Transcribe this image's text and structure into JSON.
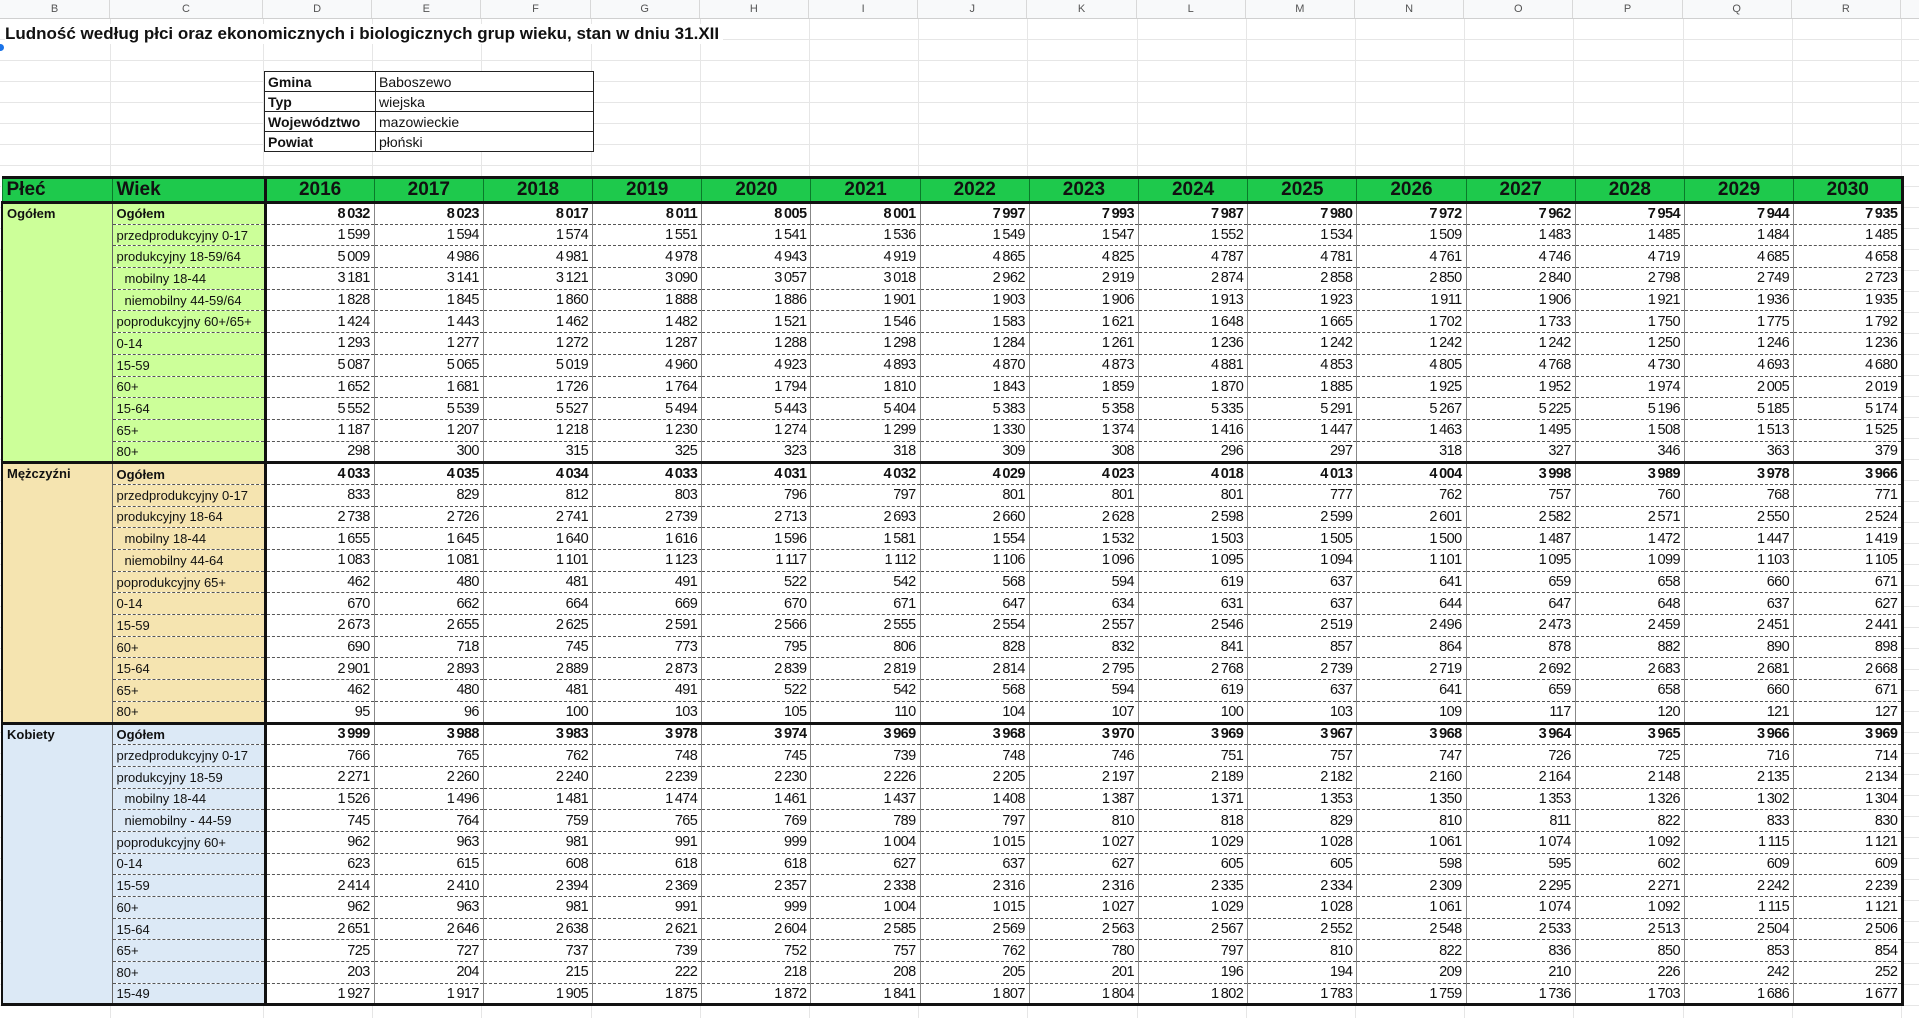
{
  "sheet": {
    "column_letters": [
      "B",
      "C",
      "D",
      "E",
      "F",
      "G",
      "H",
      "I",
      "J",
      "K",
      "L",
      "M",
      "N",
      "O",
      "P",
      "Q",
      "R"
    ]
  },
  "title": "Ludność według płci oraz ekonomicznych i biologicznych grup wieku, stan w dniu 31.XII",
  "info": [
    {
      "label": "Gmina",
      "value": "Baboszewo"
    },
    {
      "label": "Typ",
      "value": "wiejska"
    },
    {
      "label": "Województwo",
      "value": "mazowieckie"
    },
    {
      "label": "Powiat",
      "value": "płoński"
    }
  ],
  "table": {
    "header": {
      "plec": "Płeć",
      "wiek": "Wiek",
      "years": [
        "2016",
        "2017",
        "2018",
        "2019",
        "2020",
        "2021",
        "2022",
        "2023",
        "2024",
        "2025",
        "2026",
        "2027",
        "2028",
        "2029",
        "2030"
      ]
    },
    "header_color": "#1ec94c",
    "sections": [
      {
        "name": "Ogółem",
        "color": "#ccff99",
        "rows": [
          {
            "label": "Ogółem",
            "bold": true,
            "values": [
              8032,
              8023,
              8017,
              8011,
              8005,
              8001,
              7997,
              7993,
              7987,
              7980,
              7972,
              7962,
              7954,
              7944,
              7935
            ]
          },
          {
            "label": "przedprodukcyjny 0-17",
            "values": [
              1599,
              1594,
              1574,
              1551,
              1541,
              1536,
              1549,
              1547,
              1552,
              1534,
              1509,
              1483,
              1485,
              1484,
              1485
            ]
          },
          {
            "label": "produkcyjny 18-59/64",
            "values": [
              5009,
              4986,
              4981,
              4978,
              4943,
              4919,
              4865,
              4825,
              4787,
              4781,
              4761,
              4746,
              4719,
              4685,
              4658
            ]
          },
          {
            "label": "mobilny 18-44",
            "indent": true,
            "values": [
              3181,
              3141,
              3121,
              3090,
              3057,
              3018,
              2962,
              2919,
              2874,
              2858,
              2850,
              2840,
              2798,
              2749,
              2723
            ]
          },
          {
            "label": "niemobilny  44-59/64",
            "indent": true,
            "values": [
              1828,
              1845,
              1860,
              1888,
              1886,
              1901,
              1903,
              1906,
              1913,
              1923,
              1911,
              1906,
              1921,
              1936,
              1935
            ]
          },
          {
            "label": "poprodukcyjny 60+/65+",
            "values": [
              1424,
              1443,
              1462,
              1482,
              1521,
              1546,
              1583,
              1621,
              1648,
              1665,
              1702,
              1733,
              1750,
              1775,
              1792
            ]
          },
          {
            "label": "0-14",
            "values": [
              1293,
              1277,
              1272,
              1287,
              1288,
              1298,
              1284,
              1261,
              1236,
              1242,
              1242,
              1242,
              1250,
              1246,
              1236
            ]
          },
          {
            "label": "15-59",
            "values": [
              5087,
              5065,
              5019,
              4960,
              4923,
              4893,
              4870,
              4873,
              4881,
              4853,
              4805,
              4768,
              4730,
              4693,
              4680
            ]
          },
          {
            "label": "60+",
            "values": [
              1652,
              1681,
              1726,
              1764,
              1794,
              1810,
              1843,
              1859,
              1870,
              1885,
              1925,
              1952,
              1974,
              2005,
              2019
            ]
          },
          {
            "label": "15-64",
            "values": [
              5552,
              5539,
              5527,
              5494,
              5443,
              5404,
              5383,
              5358,
              5335,
              5291,
              5267,
              5225,
              5196,
              5185,
              5174
            ]
          },
          {
            "label": "65+",
            "values": [
              1187,
              1207,
              1218,
              1230,
              1274,
              1299,
              1330,
              1374,
              1416,
              1447,
              1463,
              1495,
              1508,
              1513,
              1525
            ]
          },
          {
            "label": "80+",
            "values": [
              298,
              300,
              315,
              325,
              323,
              318,
              309,
              308,
              296,
              297,
              318,
              327,
              346,
              363,
              379
            ]
          }
        ]
      },
      {
        "name": "Mężczyźni",
        "color": "#f5e4b0",
        "rows": [
          {
            "label": "Ogółem",
            "bold": true,
            "values": [
              4033,
              4035,
              4034,
              4033,
              4031,
              4032,
              4029,
              4023,
              4018,
              4013,
              4004,
              3998,
              3989,
              3978,
              3966
            ]
          },
          {
            "label": "przedprodukcyjny 0-17",
            "values": [
              833,
              829,
              812,
              803,
              796,
              797,
              801,
              801,
              801,
              777,
              762,
              757,
              760,
              768,
              771
            ]
          },
          {
            "label": "produkcyjny 18-64",
            "values": [
              2738,
              2726,
              2741,
              2739,
              2713,
              2693,
              2660,
              2628,
              2598,
              2599,
              2601,
              2582,
              2571,
              2550,
              2524
            ]
          },
          {
            "label": "mobilny 18-44",
            "indent": true,
            "values": [
              1655,
              1645,
              1640,
              1616,
              1596,
              1581,
              1554,
              1532,
              1503,
              1505,
              1500,
              1487,
              1472,
              1447,
              1419
            ]
          },
          {
            "label": "niemobilny  44-64",
            "indent": true,
            "values": [
              1083,
              1081,
              1101,
              1123,
              1117,
              1112,
              1106,
              1096,
              1095,
              1094,
              1101,
              1095,
              1099,
              1103,
              1105
            ]
          },
          {
            "label": "poprodukcyjny 65+",
            "values": [
              462,
              480,
              481,
              491,
              522,
              542,
              568,
              594,
              619,
              637,
              641,
              659,
              658,
              660,
              671
            ]
          },
          {
            "label": "0-14",
            "values": [
              670,
              662,
              664,
              669,
              670,
              671,
              647,
              634,
              631,
              637,
              644,
              647,
              648,
              637,
              627
            ]
          },
          {
            "label": "15-59",
            "values": [
              2673,
              2655,
              2625,
              2591,
              2566,
              2555,
              2554,
              2557,
              2546,
              2519,
              2496,
              2473,
              2459,
              2451,
              2441
            ]
          },
          {
            "label": "60+",
            "values": [
              690,
              718,
              745,
              773,
              795,
              806,
              828,
              832,
              841,
              857,
              864,
              878,
              882,
              890,
              898
            ]
          },
          {
            "label": "15-64",
            "values": [
              2901,
              2893,
              2889,
              2873,
              2839,
              2819,
              2814,
              2795,
              2768,
              2739,
              2719,
              2692,
              2683,
              2681,
              2668
            ]
          },
          {
            "label": "65+",
            "values": [
              462,
              480,
              481,
              491,
              522,
              542,
              568,
              594,
              619,
              637,
              641,
              659,
              658,
              660,
              671
            ]
          },
          {
            "label": "80+",
            "values": [
              95,
              96,
              100,
              103,
              105,
              110,
              104,
              107,
              100,
              103,
              109,
              117,
              120,
              121,
              127
            ]
          }
        ]
      },
      {
        "name": "Kobiety",
        "color": "#dce9f6",
        "rows": [
          {
            "label": "Ogółem",
            "bold": true,
            "values": [
              3999,
              3988,
              3983,
              3978,
              3974,
              3969,
              3968,
              3970,
              3969,
              3967,
              3968,
              3964,
              3965,
              3966,
              3969
            ]
          },
          {
            "label": "przedprodukcyjny 0-17",
            "values": [
              766,
              765,
              762,
              748,
              745,
              739,
              748,
              746,
              751,
              757,
              747,
              726,
              725,
              716,
              714
            ]
          },
          {
            "label": "produkcyjny 18-59",
            "values": [
              2271,
              2260,
              2240,
              2239,
              2230,
              2226,
              2205,
              2197,
              2189,
              2182,
              2160,
              2164,
              2148,
              2135,
              2134
            ]
          },
          {
            "label": "mobilny 18-44",
            "indent": true,
            "values": [
              1526,
              1496,
              1481,
              1474,
              1461,
              1437,
              1408,
              1387,
              1371,
              1353,
              1350,
              1353,
              1326,
              1302,
              1304
            ]
          },
          {
            "label": "niemobilny - 44-59",
            "indent": true,
            "values": [
              745,
              764,
              759,
              765,
              769,
              789,
              797,
              810,
              818,
              829,
              810,
              811,
              822,
              833,
              830
            ]
          },
          {
            "label": "poprodukcyjny 60+",
            "values": [
              962,
              963,
              981,
              991,
              999,
              1004,
              1015,
              1027,
              1029,
              1028,
              1061,
              1074,
              1092,
              1115,
              1121
            ]
          },
          {
            "label": "0-14",
            "values": [
              623,
              615,
              608,
              618,
              618,
              627,
              637,
              627,
              605,
              605,
              598,
              595,
              602,
              609,
              609
            ]
          },
          {
            "label": "15-59",
            "values": [
              2414,
              2410,
              2394,
              2369,
              2357,
              2338,
              2316,
              2316,
              2335,
              2334,
              2309,
              2295,
              2271,
              2242,
              2239
            ]
          },
          {
            "label": "60+",
            "values": [
              962,
              963,
              981,
              991,
              999,
              1004,
              1015,
              1027,
              1029,
              1028,
              1061,
              1074,
              1092,
              1115,
              1121
            ]
          },
          {
            "label": "15-64",
            "values": [
              2651,
              2646,
              2638,
              2621,
              2604,
              2585,
              2569,
              2563,
              2567,
              2552,
              2548,
              2533,
              2513,
              2504,
              2506
            ]
          },
          {
            "label": "65+",
            "values": [
              725,
              727,
              737,
              739,
              752,
              757,
              762,
              780,
              797,
              810,
              822,
              836,
              850,
              853,
              854
            ]
          },
          {
            "label": "80+",
            "values": [
              203,
              204,
              215,
              222,
              218,
              208,
              205,
              201,
              196,
              194,
              209,
              210,
              226,
              242,
              252
            ]
          },
          {
            "label": "15-49",
            "values": [
              1927,
              1917,
              1905,
              1875,
              1872,
              1841,
              1807,
              1804,
              1802,
              1783,
              1759,
              1736,
              1703,
              1686,
              1677
            ]
          }
        ]
      }
    ]
  }
}
